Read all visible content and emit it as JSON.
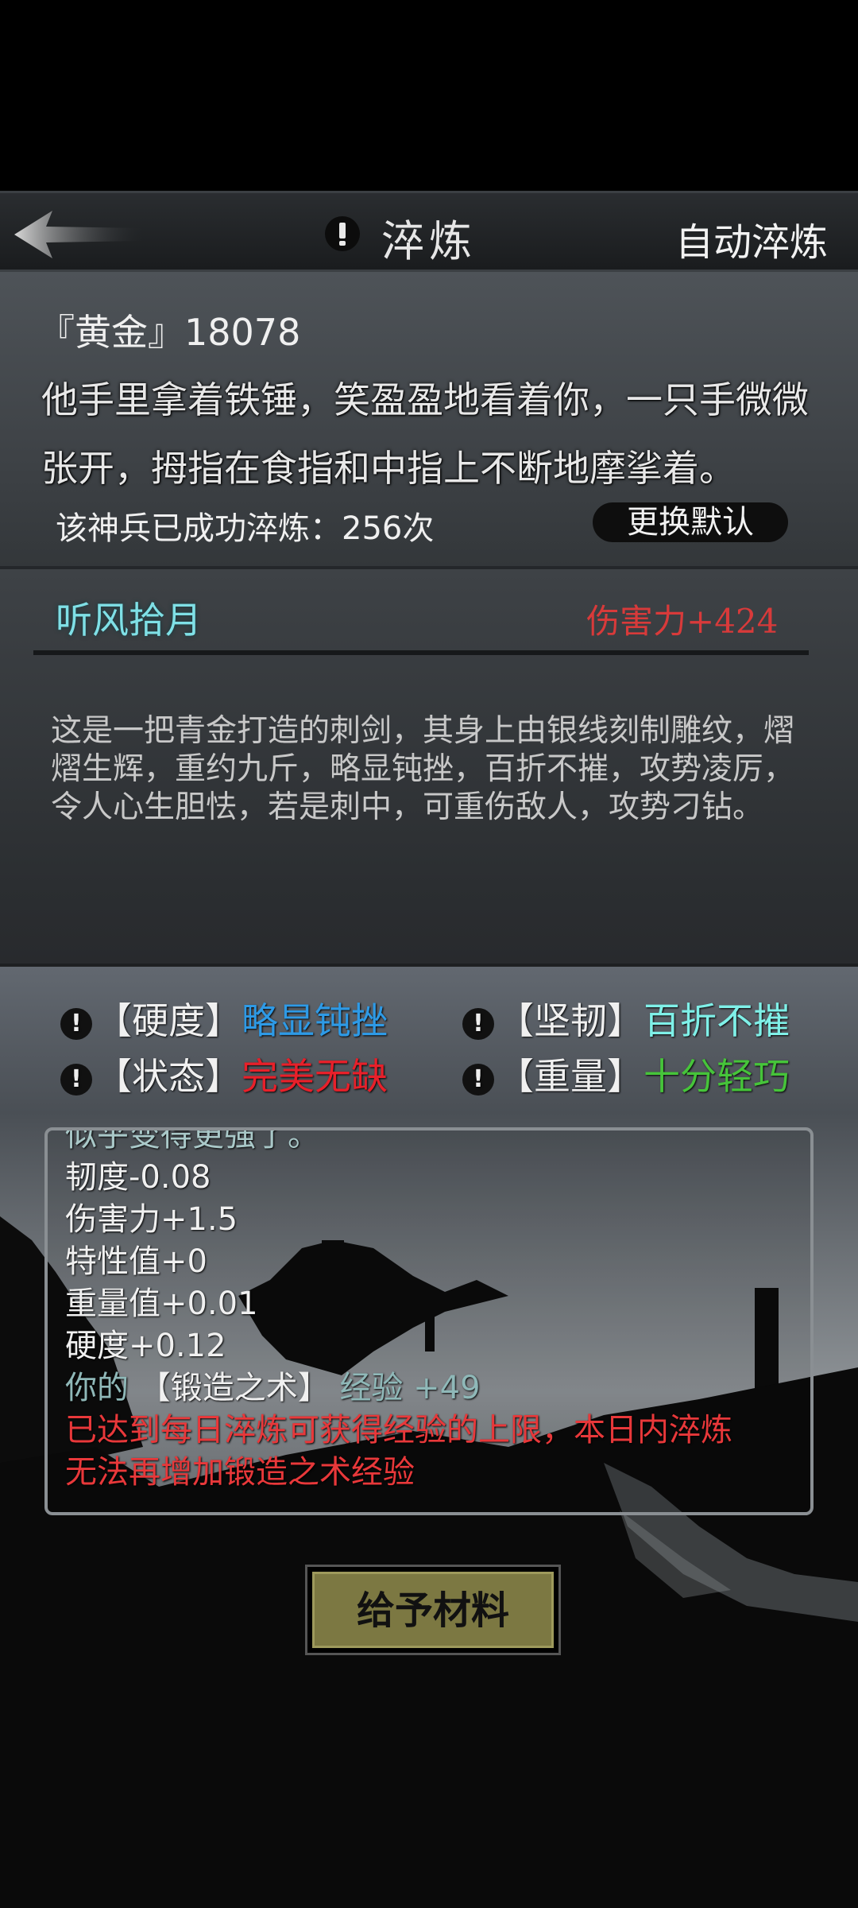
{
  "header": {
    "title": "淬炼",
    "auto_refine_label": "自动淬炼",
    "icons": {
      "back": "back-arrow-icon",
      "info": "exclamation-info-icon"
    }
  },
  "owner": {
    "name": "『黄金』18078",
    "description": "他手里拿着铁锤，笑盈盈地看着你，一只手微微张开，拇指在食指和中指上不断地摩挲着。",
    "refine_count_text": "该神兵已成功淬炼：256次",
    "change_default_label": "更换默认"
  },
  "weapon": {
    "name": "听风拾月",
    "damage_text": "伤害力+424",
    "description": "这是一把青金打造的刺剑，其身上由银线刻制雕纹，熠熠生辉，重约九斤，略显钝挫，百折不摧，攻势凌厉，令人心生胆怯，若是刺中，可重伤敌人，攻势刁钻。"
  },
  "attributes": [
    {
      "label": "【硬度】",
      "value": "略显钝挫",
      "color": "#2e9ae6"
    },
    {
      "label": "【坚韧】",
      "value": "百折不摧",
      "color": "#7ff0e8"
    },
    {
      "label": "【状态】",
      "value": "完美无缺",
      "color": "#e8202a"
    },
    {
      "label": "【重量】",
      "value": "十分轻巧",
      "color": "#46c43a"
    }
  ],
  "log": {
    "partial_top": "似乎变得更强了。",
    "lines": [
      "韧度-0.08",
      "伤害力+1.5",
      "特性值+0",
      "重量值+0.01",
      "硬度+0.12"
    ],
    "exp_prefix": "你的",
    "exp_skill": "【锻造之术】",
    "exp_suffix": "经验 +49",
    "warning_line1": "已达到每日淬炼可获得经验的上限，本日内淬炼",
    "warning_line2": "无法再增加锻造之术经验"
  },
  "actions": {
    "give_materials_label": "给予材料"
  }
}
